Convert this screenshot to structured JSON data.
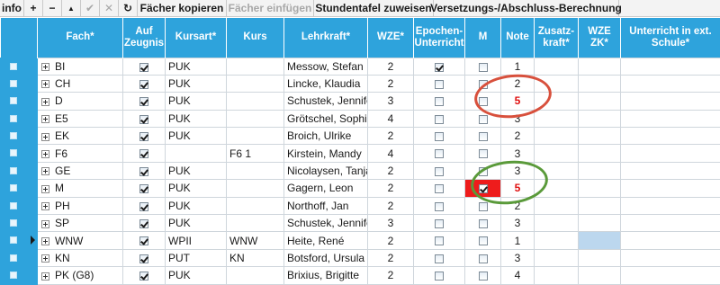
{
  "toolbar": {
    "info": "info",
    "add": "+",
    "remove": "−",
    "up": "▲",
    "confirm": "✔",
    "cancel": "✕",
    "refresh": "↻",
    "copy_subjects": "Fächer kopieren",
    "paste_subjects": "Fächer einfügen",
    "assign_timetable": "Stundentafel zuweisen",
    "promotion_calc": "Versetzungs-/Abschluss-Berechnung"
  },
  "columns": {
    "fach": "Fach*",
    "auf_zeugnis": "Auf Zeugnis",
    "kursart": "Kursart*",
    "kurs": "Kurs",
    "lehrkraft": "Lehrkraft*",
    "wze": "WZE*",
    "epochen": "Epochen-Unterricht",
    "m": "M",
    "note": "Note",
    "zusatzkraft": "Zusatz-kraft*",
    "wze_zk": "WZE ZK*",
    "ext_schule": "Unterricht in ext. Schule*"
  },
  "rows": [
    {
      "fach": "BI",
      "auf_zeugnis": true,
      "kursart": "PUK",
      "kurs": "",
      "lehrkraft": "Messow, Stefan",
      "wze": "2",
      "epochen": true,
      "m": false,
      "note": "1"
    },
    {
      "fach": "CH",
      "auf_zeugnis": true,
      "kursart": "PUK",
      "kurs": "",
      "lehrkraft": "Lincke, Klaudia",
      "wze": "2",
      "epochen": false,
      "m": false,
      "note": "2"
    },
    {
      "fach": "D",
      "auf_zeugnis": true,
      "kursart": "PUK",
      "kurs": "",
      "lehrkraft": "Schustek, Jennifer",
      "wze": "3",
      "epochen": false,
      "m": false,
      "note": "5"
    },
    {
      "fach": "E5",
      "auf_zeugnis": true,
      "kursart": "PUK",
      "kurs": "",
      "lehrkraft": "Grötschel, Sophie",
      "wze": "4",
      "epochen": false,
      "m": false,
      "note": "3"
    },
    {
      "fach": "EK",
      "auf_zeugnis": true,
      "kursart": "PUK",
      "kurs": "",
      "lehrkraft": "Broich, Ulrike",
      "wze": "2",
      "epochen": false,
      "m": false,
      "note": "2"
    },
    {
      "fach": "F6",
      "auf_zeugnis": true,
      "kursart": "",
      "kurs": "F6 1",
      "lehrkraft": "Kirstein, Mandy",
      "wze": "4",
      "epochen": false,
      "m": false,
      "note": "3"
    },
    {
      "fach": "GE",
      "auf_zeugnis": true,
      "kursart": "PUK",
      "kurs": "",
      "lehrkraft": "Nicolaysen, Tanja",
      "wze": "2",
      "epochen": false,
      "m": false,
      "note": "3"
    },
    {
      "fach": "M",
      "auf_zeugnis": true,
      "kursart": "PUK",
      "kurs": "",
      "lehrkraft": "Gagern, Leon",
      "wze": "2",
      "epochen": false,
      "m": true,
      "note": "5"
    },
    {
      "fach": "PH",
      "auf_zeugnis": true,
      "kursart": "PUK",
      "kurs": "",
      "lehrkraft": "Northoff, Jan",
      "wze": "2",
      "epochen": false,
      "m": false,
      "note": "2"
    },
    {
      "fach": "SP",
      "auf_zeugnis": true,
      "kursart": "PUK",
      "kurs": "",
      "lehrkraft": "Schustek, Jennifer",
      "wze": "3",
      "epochen": false,
      "m": false,
      "note": "3"
    },
    {
      "fach": "WNW",
      "auf_zeugnis": true,
      "kursart": "WPII",
      "kurs": "WNW",
      "lehrkraft": "Heite, René",
      "wze": "2",
      "epochen": false,
      "m": false,
      "note": "1"
    },
    {
      "fach": "KN",
      "auf_zeugnis": true,
      "kursart": "PUT",
      "kurs": "KN",
      "lehrkraft": "Botsford, Ursula",
      "wze": "2",
      "epochen": false,
      "m": false,
      "note": "3"
    },
    {
      "fach": "PK (G8)",
      "auf_zeugnis": true,
      "kursart": "PUK",
      "kurs": "",
      "lehrkraft": "Brixius, Brigitte",
      "wze": "2",
      "epochen": false,
      "m": false,
      "note": "4"
    }
  ],
  "colors": {
    "header_blue": "#2ea3dc",
    "failing_grade": "#e01010",
    "highlight_red": "#ee1c1c",
    "annotation_red_ellipse": "#d8503c",
    "annotation_green_ellipse": "#5a9a3a",
    "selected_cell_blue": "#bcd7ee"
  }
}
